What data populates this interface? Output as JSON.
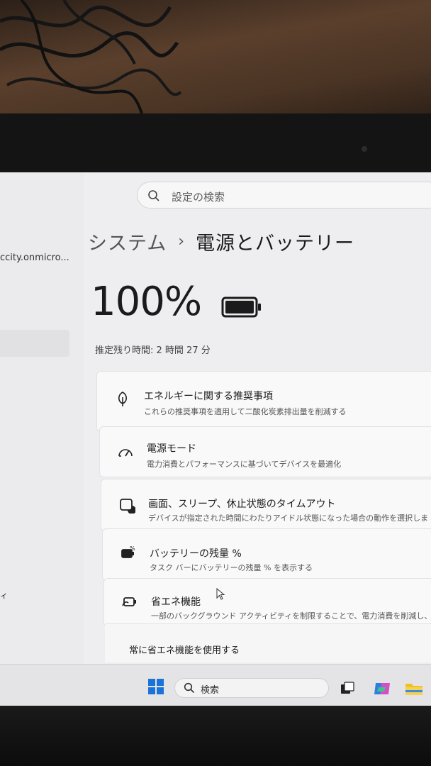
{
  "search": {
    "placeholder": "設定の検索"
  },
  "sidebar": {
    "account": "ccity.onmicro...",
    "fragment": "ィ"
  },
  "breadcrumb": {
    "parent": "システム",
    "separator": "›",
    "current": "電源とバッテリー"
  },
  "battery": {
    "percent": "100%",
    "level": 1.0,
    "remaining": "推定残り時間: 2 時間 27 分"
  },
  "cards": [
    {
      "title": "エネルギーに関する推奨事項",
      "desc": "これらの推奨事項を適用して二酸化炭素排出量を削減する",
      "icon": "leaf-icon"
    },
    {
      "title": "電源モード",
      "desc": "電力消費とパフォーマンスに基づいてデバイスを最適化",
      "icon": "power-mode-icon"
    },
    {
      "title": "画面、スリープ、休止状態のタイムアウト",
      "desc": "デバイスが指定された時間にわたりアイドル状態になった場合の動作を選択しま",
      "icon": "screen-sleep-icon"
    },
    {
      "title": "バッテリーの残量 %",
      "desc": "タスク バーにバッテリーの残量 % を表示する",
      "icon": "battery-percent-icon"
    },
    {
      "title": "省エネ機能",
      "desc": "一部のバックグラウンド アクティビティを制限することで、電力消費を削減し、バッテリ",
      "icon": "energy-saver-icon"
    }
  ],
  "energy_saver_option": "常に省エネ機能を使用する",
  "taskbar": {
    "search_label": "検索"
  },
  "colors": {
    "screen_bg": "#eeeef0",
    "card_bg": "#f9f9fa",
    "bezel": "#141414"
  }
}
